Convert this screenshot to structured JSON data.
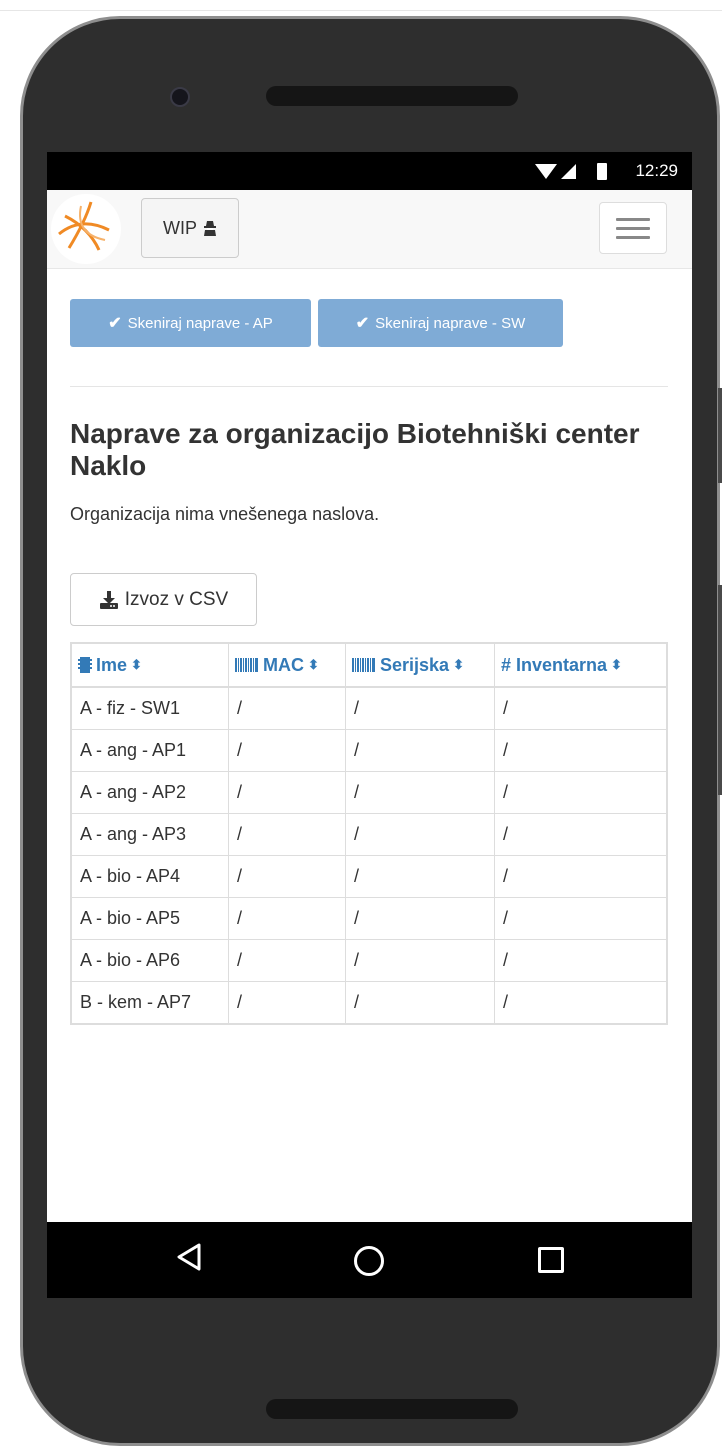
{
  "status_bar": {
    "time": "12:29"
  },
  "navbar": {
    "wip_label": "WIP"
  },
  "actions": {
    "scan_ap_label": "Skeniraj naprave - AP",
    "scan_sw_label": "Skeniraj naprave - SW",
    "export_label": "Izvoz v CSV"
  },
  "page": {
    "title": "Naprave za organizacijo Biotehniški center Naklo",
    "subtitle": "Organizacija nima vnešenega naslova."
  },
  "table": {
    "columns": [
      {
        "label": "Ime",
        "icon": "microchip-icon"
      },
      {
        "label": "MAC",
        "icon": "barcode-icon"
      },
      {
        "label": "Serijska",
        "icon": "barcode-icon"
      },
      {
        "label": "# Inventarna",
        "icon": ""
      }
    ],
    "rows": [
      [
        "A - fiz - SW1",
        "/",
        "/",
        "/"
      ],
      [
        "A - ang - AP1",
        "/",
        "/",
        "/"
      ],
      [
        "A - ang - AP2",
        "/",
        "/",
        "/"
      ],
      [
        "A - ang - AP3",
        "/",
        "/",
        "/"
      ],
      [
        "A - bio - AP4",
        "/",
        "/",
        "/"
      ],
      [
        "A - bio - AP5",
        "/",
        "/",
        "/"
      ],
      [
        "A - bio - AP6",
        "/",
        "/",
        "/"
      ],
      [
        "B - kem - AP7",
        "/",
        "/",
        "/"
      ]
    ]
  },
  "colors": {
    "primary_light": "#7fabd6",
    "link_blue": "#337ab7",
    "logo_orange": "#f08a24"
  }
}
